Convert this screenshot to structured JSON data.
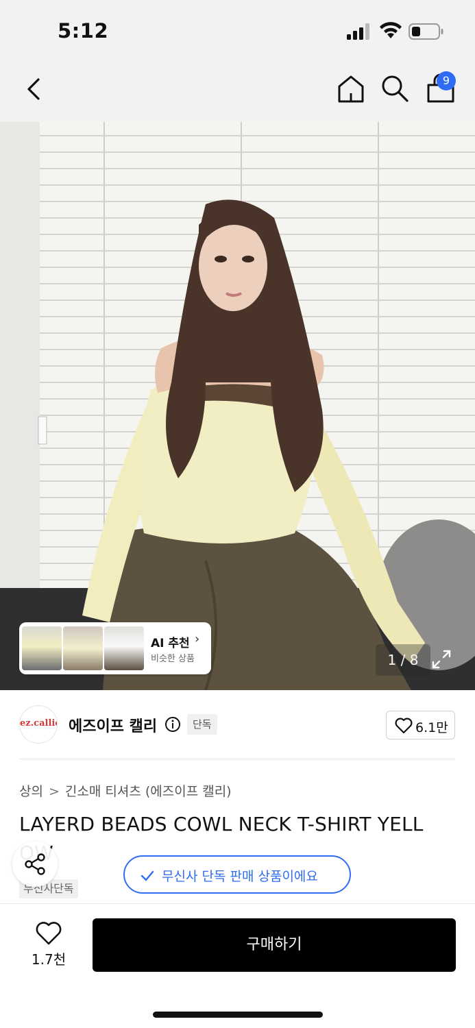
{
  "status_bar": {
    "time": "5:12"
  },
  "nav": {
    "cart_count": "9"
  },
  "hero": {
    "ai_recommend": {
      "title": "AI 추천",
      "chevron": "›",
      "subtitle": "비슷한 상품"
    },
    "image_counter": "1 / 8"
  },
  "brand": {
    "logo_text": "ez.callie",
    "name": "에즈이프 캘리",
    "badge": "단독",
    "likes": "6.1만"
  },
  "product": {
    "breadcrumb": [
      "상의",
      "긴소매 티셔츠 (에즈이프 캘리)"
    ],
    "breadcrumb_sep": ">",
    "title_line1": "LAYERD BEADS COWL NECK T-SHIRT YELL",
    "title_line2": "OW",
    "exclusive_tag": "무신사단독",
    "verify_text": "무신사 단독 판매 상품이에요"
  },
  "bottom": {
    "like_count": "1.7천",
    "buy_label": "구매하기"
  },
  "colors": {
    "accent_blue": "#2f6cf5",
    "buy_bg": "#000000",
    "brand_red": "#d23a3a"
  }
}
